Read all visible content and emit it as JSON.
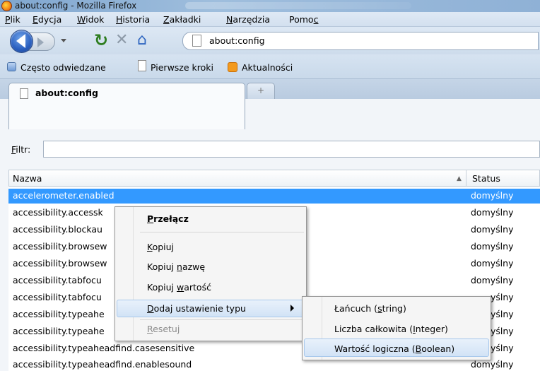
{
  "window": {
    "title": "about:config - Mozilla Firefox"
  },
  "menubar": [
    {
      "pre": "",
      "key": "P",
      "post": "lik"
    },
    {
      "pre": "",
      "key": "E",
      "post": "dycja"
    },
    {
      "pre": "",
      "key": "W",
      "post": "idok"
    },
    {
      "pre": "",
      "key": "H",
      "post": "istoria"
    },
    {
      "pre": "",
      "key": "Z",
      "post": "akładki"
    },
    {
      "pre": "",
      "key": "N",
      "post": "arzędzia"
    },
    {
      "pre": "Pomo",
      "key": "c",
      "post": ""
    }
  ],
  "url": "about:config",
  "bookmarks": [
    "Często odwiedzane",
    "Pierwsze kroki",
    "Aktualności"
  ],
  "tab": {
    "label": "about:config",
    "new_tab": "+"
  },
  "filter": {
    "label_key": "F",
    "label_rest": "iltr:",
    "value": ""
  },
  "columns": {
    "name": "Nazwa",
    "status": "Status"
  },
  "rows": [
    {
      "name": "accelerometer.enabled",
      "status": "domyślny"
    },
    {
      "name": "accessibility.accessk",
      "status": "domyślny"
    },
    {
      "name": "accessibility.blockau",
      "status": "domyślny"
    },
    {
      "name": "accessibility.browsew",
      "status": "domyślny"
    },
    {
      "name": "accessibility.browsew",
      "status": "domyślny"
    },
    {
      "name": "accessibility.tabfocu",
      "status": "domyślny"
    },
    {
      "name": "accessibility.tabfocu",
      "status": "yślny"
    },
    {
      "name": "accessibility.typeahe",
      "status": "yślny"
    },
    {
      "name": "accessibility.typeahe",
      "status": "yślny"
    },
    {
      "name": "accessibility.typeaheadfind.casesensitive",
      "status": "yślny"
    },
    {
      "name": "accessibility.typeaheadfind.enablesound",
      "status": "domyślny"
    }
  ],
  "context_menu": {
    "toggle": {
      "pre": "",
      "key": "P",
      "post": "rzełącz"
    },
    "copy": {
      "pre": "",
      "key": "K",
      "post": "opiuj"
    },
    "copy_name": {
      "pre": "Kopiuj ",
      "key": "n",
      "post": "azwę"
    },
    "copy_value": {
      "pre": "Kopiuj ",
      "key": "w",
      "post": "artość"
    },
    "add_setting": {
      "pre": "",
      "key": "D",
      "post": "odaj ustawienie typu"
    },
    "reset": {
      "pre": "",
      "key": "R",
      "post": "esetuj"
    }
  },
  "submenu": {
    "string": {
      "pre": "Łańcuch (",
      "key": "s",
      "post": "tring)"
    },
    "integer": {
      "pre": "Liczba całkowita (",
      "key": "I",
      "post": "nteger)"
    },
    "boolean": {
      "pre": "Wartość logiczna (",
      "key": "B",
      "post": "oolean)"
    }
  },
  "colors": {
    "selection": "#3399ff",
    "menu_highlight": "#d2e3f6",
    "disabled_text": "#8a8a8a"
  },
  "icons": {
    "app": "firefox-icon",
    "back": "back-arrow-icon",
    "forward": "forward-arrow-icon",
    "reload": "reload-icon",
    "stop": "stop-icon",
    "home": "home-icon",
    "page": "page-icon",
    "bookmark_1": "most-visited-icon",
    "bookmark_2": "page-icon",
    "bookmark_3": "rss-feed-icon"
  }
}
